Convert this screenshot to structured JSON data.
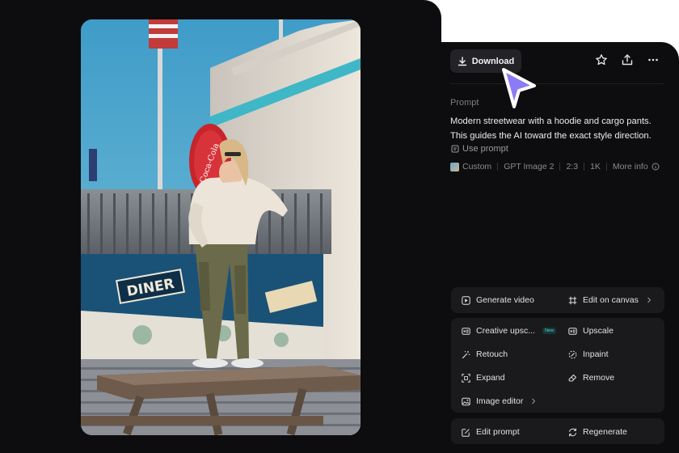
{
  "toolbar": {
    "download_label": "Download"
  },
  "prompt": {
    "label": "Prompt",
    "text": "Modern streetwear with a hoodie and cargo pants. This guides the AI toward the exact style direction.",
    "use_prompt_label": "Use prompt"
  },
  "meta": {
    "style": "Custom",
    "model": "GPT Image 2",
    "ratio": "2:3",
    "resolution": "1K",
    "more_info": "More info"
  },
  "actions": {
    "generate_video": "Generate video",
    "edit_on_canvas": "Edit on canvas",
    "creative_upscale": "Creative upsc...",
    "new_badge": "New",
    "upscale": "Upscale",
    "retouch": "Retouch",
    "inpaint": "Inpaint",
    "expand": "Expand",
    "remove": "Remove",
    "image_editor": "Image editor",
    "edit_prompt": "Edit prompt",
    "regenerate": "Regenerate"
  },
  "photo_signs": {
    "diner": "DINER",
    "sign": "Coca-Cola"
  },
  "colors": {
    "panel_bg": "#0d0d0f",
    "card_bg": "#1a1a1d",
    "cursor_accent": "#8b7cf6",
    "new_badge": "#5fd2c7"
  },
  "icons": [
    "download-icon",
    "star-icon",
    "share-icon",
    "more-icon",
    "cursor-icon",
    "play-icon",
    "canvas-icon",
    "upscale-hd-icon",
    "wand-icon",
    "expand-icon",
    "eraser-icon",
    "image-icon",
    "edit-icon",
    "refresh-icon"
  ]
}
